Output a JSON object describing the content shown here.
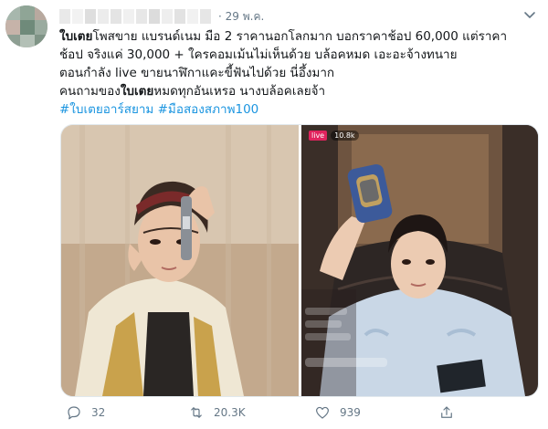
{
  "tweet": {
    "timestamp": "· 29 พ.ค.",
    "text_lines": [
      [
        {
          "t": "ใบเตย",
          "b": true
        },
        {
          "t": "โพสขาย แบรนด์เนม มือ 2 ราคานอกโลกมาก บอกราคาช้อป 60,000 แต่ราคา",
          "b": false
        }
      ],
      [
        {
          "t": "ช้อป จริงแค่ 30,000 + ใครคอมเม้นไม่เห็นด้วย บล้อคหมด เอะอะจ้างทนาย",
          "b": false
        }
      ],
      [
        {
          "t": "ตอนกำลัง live ขายนาฬิกาแคะขี้ฟันไปด้วย นี่อึ้งมาก",
          "b": false
        }
      ],
      [
        {
          "t": "คนถามของ",
          "b": false
        },
        {
          "t": "ใบเตย",
          "b": true
        },
        {
          "t": "หมดทุกอันเหรอ นางบล้อคเลยจ้า",
          "b": false
        }
      ]
    ],
    "hashtags": "#ใบเตยอาร์สยาม #มือสองสภาพ100",
    "live_tag": "live",
    "live_viewers": "10.8k",
    "replies": "32",
    "retweets": "20.3K",
    "likes": "939"
  },
  "icons": {
    "reply": "reply-icon",
    "retweet": "retweet-icon",
    "like": "heart-icon",
    "share": "share-icon",
    "caret": "chevron-down-icon"
  },
  "colors": {
    "link": "#1b95e0",
    "muted": "#657786",
    "text": "#14171a"
  }
}
